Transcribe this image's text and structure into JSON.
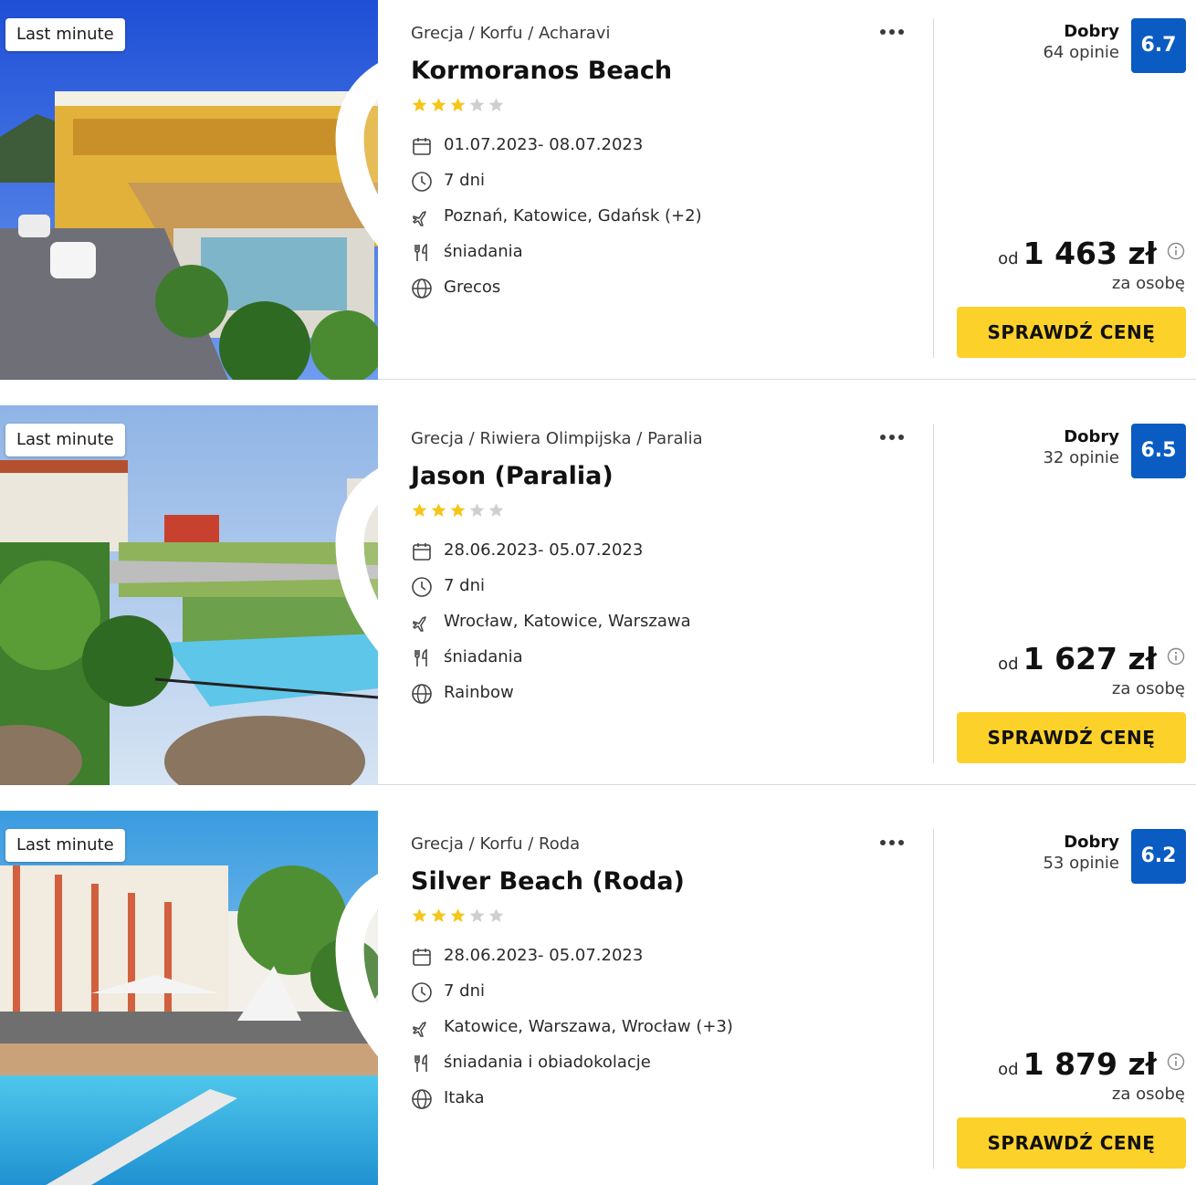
{
  "colors": {
    "accent_yellow": "#fcd12a",
    "score_blue": "#0a5cc2",
    "star_gold": "#f5c518",
    "star_grey": "#cfcfcf"
  },
  "offers": [
    {
      "badge": "Last minute",
      "breadcrumb": "Grecja / Korfu / Acharavi",
      "name": "Kormoranos Beach",
      "stars_filled": 3,
      "stars_total": 5,
      "dates": "01.07.2023- 08.07.2023",
      "duration": "7 dni",
      "airports": "Poznań, Katowice, Gdańsk  (+2)",
      "board": "śniadania",
      "operator": "Grecos",
      "rating_label": "Dobry",
      "reviews": "64 opinie",
      "score": "6.7",
      "price_prefix": "od",
      "price": "1 463 zł",
      "price_unit": "za osobę",
      "cta": "SPRAWDŹ CENĘ",
      "icons": [
        "heart-icon",
        "more-dots-icon",
        "calendar-icon",
        "clock-icon",
        "plane-icon",
        "cutlery-icon",
        "globe-icon",
        "info-icon"
      ]
    },
    {
      "badge": "Last minute",
      "breadcrumb": "Grecja / Riwiera Olimpijska / Paralia",
      "name": "Jason (Paralia)",
      "stars_filled": 3,
      "stars_total": 5,
      "dates": "28.06.2023- 05.07.2023",
      "duration": "7 dni",
      "airports": "Wrocław, Katowice, Warszawa",
      "board": "śniadania",
      "operator": "Rainbow",
      "rating_label": "Dobry",
      "reviews": "32 opinie",
      "score": "6.5",
      "price_prefix": "od",
      "price": "1 627 zł",
      "price_unit": "za osobę",
      "cta": "SPRAWDŹ CENĘ",
      "icons": [
        "heart-icon",
        "more-dots-icon",
        "calendar-icon",
        "clock-icon",
        "plane-icon",
        "cutlery-icon",
        "globe-icon",
        "info-icon"
      ]
    },
    {
      "badge": "Last minute",
      "breadcrumb": "Grecja / Korfu / Roda",
      "name": "Silver Beach (Roda)",
      "stars_filled": 3,
      "stars_total": 5,
      "dates": "28.06.2023- 05.07.2023",
      "duration": "7 dni",
      "airports": "Katowice, Warszawa, Wrocław  (+3)",
      "board": "śniadania i obiadokolacje",
      "operator": "Itaka",
      "rating_label": "Dobry",
      "reviews": "53 opinie",
      "score": "6.2",
      "price_prefix": "od",
      "price": "1 879 zł",
      "price_unit": "za osobę",
      "cta": "SPRAWDŹ CENĘ",
      "icons": [
        "heart-icon",
        "more-dots-icon",
        "calendar-icon",
        "clock-icon",
        "plane-icon",
        "cutlery-icon",
        "globe-icon",
        "info-icon"
      ]
    }
  ]
}
